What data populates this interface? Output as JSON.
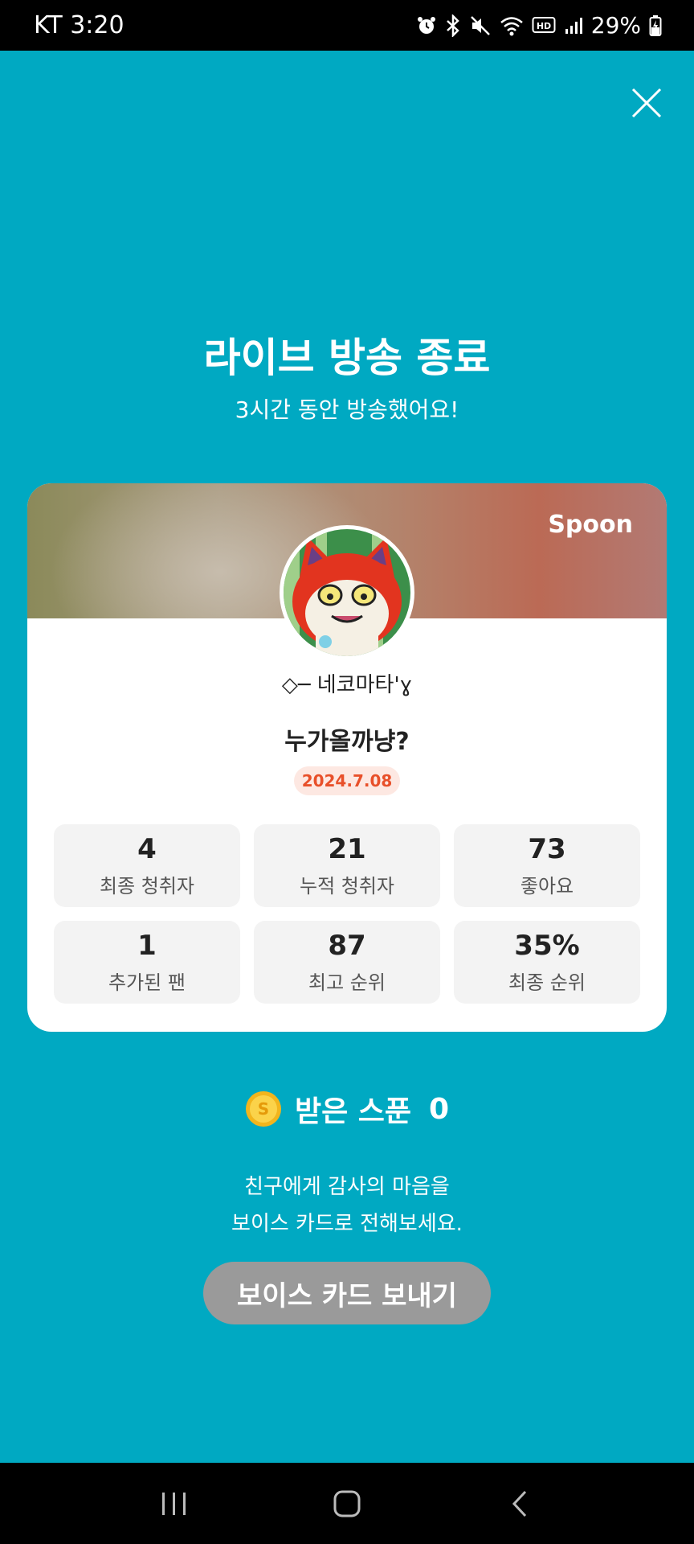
{
  "status_bar": {
    "carrier": "KT",
    "time": "3:20",
    "battery": "29%",
    "icons": [
      "alarm-icon",
      "bluetooth-icon",
      "mute-icon",
      "wifi-icon",
      "hd-icon",
      "signal-icon",
      "battery-charging-icon"
    ]
  },
  "header": {
    "title": "라이브 방송 종료",
    "subtitle": "3시간 동안 방송했어요!"
  },
  "card": {
    "brand": "Spoon",
    "nickname": "◇─ 네코마타'ɣ",
    "broadcast_title": "누가올까냥?",
    "date": "2024.7.08",
    "stats": [
      {
        "value": "4",
        "label": "최종 청취자"
      },
      {
        "value": "21",
        "label": "누적 청취자"
      },
      {
        "value": "73",
        "label": "좋아요"
      },
      {
        "value": "1",
        "label": "추가된 팬"
      },
      {
        "value": "87",
        "label": "최고 순위"
      },
      {
        "value": "35%",
        "label": "최종 순위"
      }
    ]
  },
  "spoon": {
    "label": "받은 스푼",
    "count": "0"
  },
  "message": {
    "line1": "친구에게 감사의 마음을",
    "line2": "보이스 카드로 전해보세요."
  },
  "voice_card_button": "보이스 카드 보내기",
  "colors": {
    "background": "#00a9c2",
    "date_badge_text": "#e8502a",
    "button_disabled": "#9a9a9a"
  }
}
